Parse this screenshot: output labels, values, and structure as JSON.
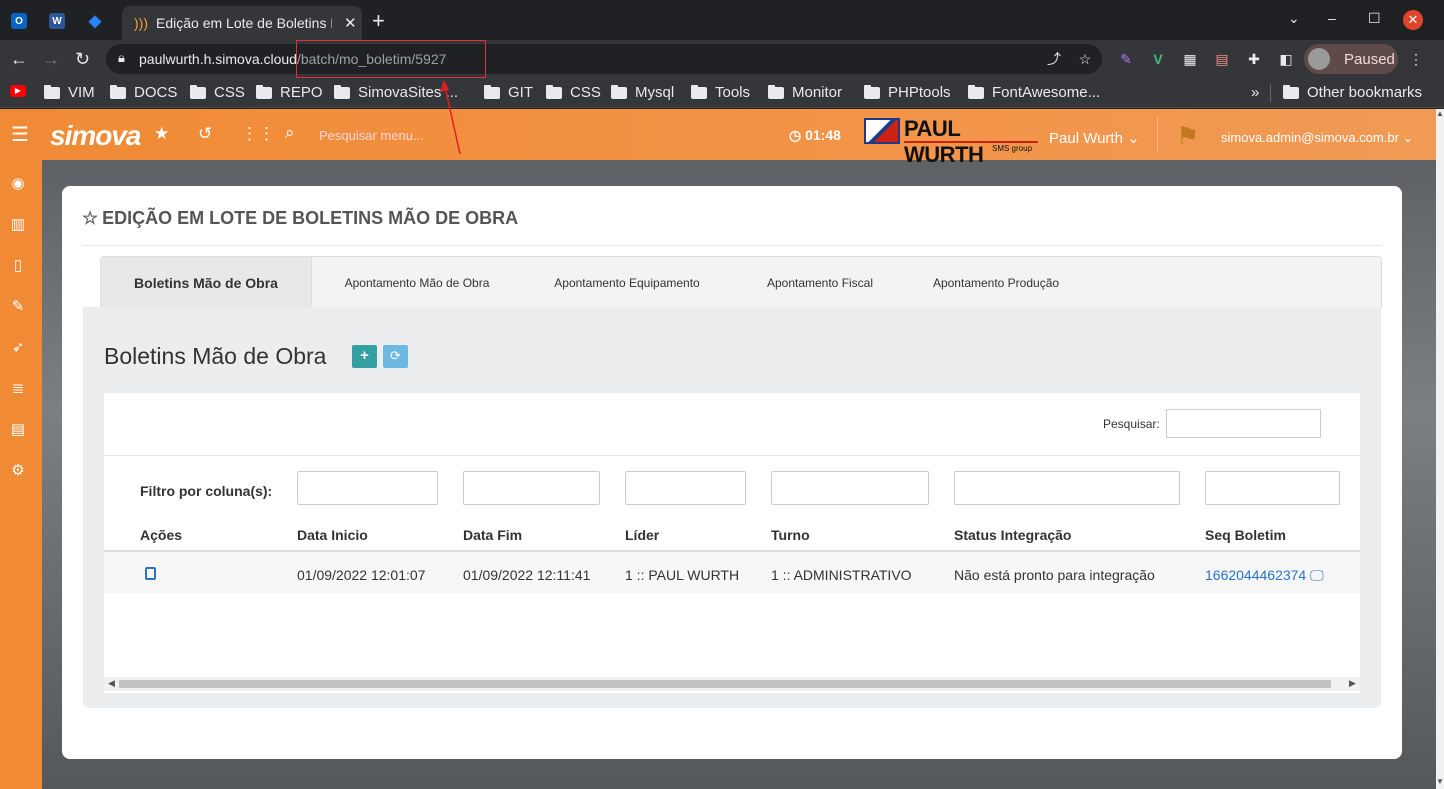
{
  "browser": {
    "tab_title": "Edição em Lote de Boletins Mão de Obra",
    "url_host": "paulwurth.h.simova.cloud",
    "url_path": "/batch/mo_boletim/5927",
    "profile_label": "Paused",
    "bookmarks": [
      "VIM",
      "DOCS",
      "CSS",
      "REPO",
      "SimovaSites ...",
      "GIT",
      "CSS",
      "Mysql",
      "Tools",
      "Monitor",
      "PHPtools",
      "FontAwesome...",
      "Other bookmarks"
    ],
    "overflow_label": "»"
  },
  "app": {
    "logo": "simova",
    "search_placeholder": "Pesquisar menu...",
    "timer": "01:48",
    "company_logo": "PAUL WURTH",
    "company_logo_sub": "SMS group",
    "company_name": "Paul Wurth",
    "user_email": "simova.admin@simova.com.br"
  },
  "page": {
    "title": "EDIÇÃO EM LOTE DE BOLETINS MÃO DE OBRA",
    "tabs": [
      "Boletins Mão de Obra",
      "Apontamento Mão de Obra",
      "Apontamento Equipamento",
      "Apontamento Fiscal",
      "Apontamento Produção"
    ],
    "panel_title": "Boletins Mão de Obra",
    "search_label": "Pesquisar:",
    "filter_label": "Filtro por coluna(s):",
    "columns": [
      "Ações",
      "Data Inicio",
      "Data Fim",
      "Líder",
      "Turno",
      "Status Integração",
      "Seq Boletim"
    ],
    "rows": [
      {
        "data_inicio": "01/09/2022 12:01:07",
        "data_fim": "01/09/2022 12:11:41",
        "lider": "1 :: PAUL WURTH",
        "turno": "1 :: ADMINISTRATIVO",
        "status": "Não está pronto para integração",
        "seq": "1662044462374"
      }
    ]
  },
  "colors": {
    "accent": "#f08a35",
    "btn_add": "#34a0a4",
    "btn_refresh": "#6cb8e0",
    "link": "#2a72c8",
    "highlight": "#dd3333"
  }
}
